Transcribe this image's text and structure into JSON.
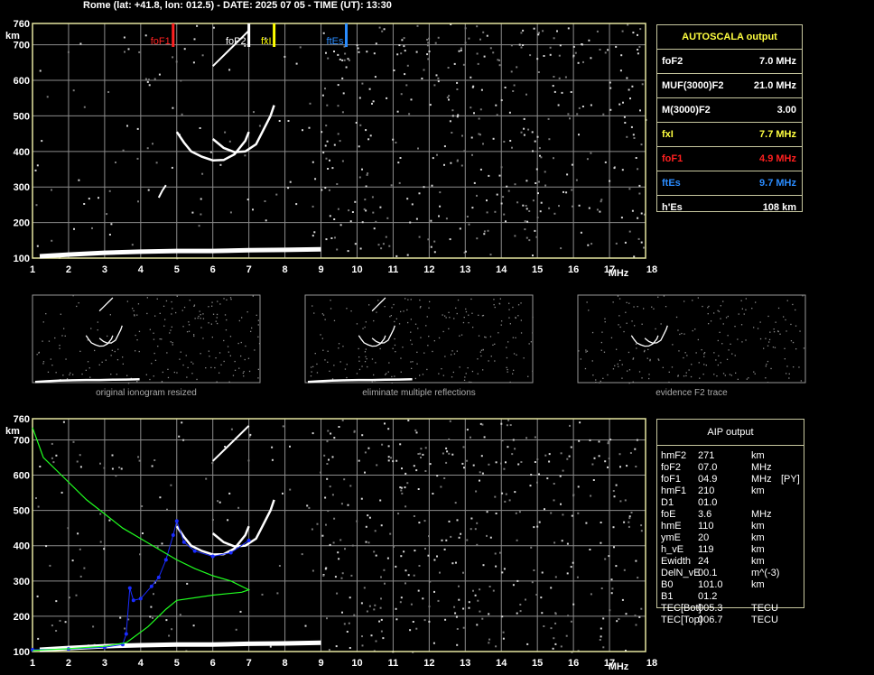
{
  "header": {
    "text": "Rome (lat: +41.8, lon: 012.5) - DATE: 2025 07 05 - TIME (UT): 13:30"
  },
  "colors": {
    "grid": "#8c8c8c",
    "frame": "#e6e6a0",
    "foF1": "#ff2020",
    "foF2": "#ffffff",
    "fxI": "#ffff00",
    "ftEs": "#2a8cff",
    "profile": "#20ff20",
    "aip_trace": "#1a2cff",
    "noise": "#d8d8d8"
  },
  "main_chart": {
    "x_ticks": [
      "1",
      "2",
      "3",
      "4",
      "5",
      "6",
      "7",
      "8",
      "9",
      "10",
      "11",
      "12",
      "13",
      "14",
      "15",
      "16",
      "17",
      "18"
    ],
    "x_unit": "MHz",
    "y_ticks": [
      "100",
      "200",
      "300",
      "400",
      "500",
      "600",
      "700",
      "760"
    ],
    "y_unit": "km",
    "markers": [
      {
        "label": "foF1",
        "freq": 4.9
      },
      {
        "label": "foP2",
        "freq": 7.0
      },
      {
        "label": "fxI",
        "freq": 7.7
      },
      {
        "label": "ftEs",
        "freq": 9.7
      }
    ]
  },
  "thumbnails": [
    {
      "caption": "original ionogram resized"
    },
    {
      "caption": "eliminate multiple reflections"
    },
    {
      "caption": "evidence F2 trace"
    }
  ],
  "autoscala": {
    "title": "AUTOSCALA output",
    "rows": [
      {
        "key": "foF2",
        "value": "7.0 MHz",
        "color": "#ffffff"
      },
      {
        "key": "MUF(3000)F2",
        "value": "21.0 MHz",
        "color": "#ffffff"
      },
      {
        "key": "M(3000)F2",
        "value": "3.00",
        "color": "#ffffff"
      },
      {
        "key": "fxI",
        "value": "7.7 MHz",
        "color": "#ffff40"
      },
      {
        "key": "foF1",
        "value": "4.9 MHz",
        "color": "#ff2020"
      },
      {
        "key": "ftEs",
        "value": "9.7 MHz",
        "color": "#2a8cff"
      },
      {
        "key": "h'Es",
        "value": "108    km",
        "color": "#ffffff"
      }
    ]
  },
  "aip": {
    "title": "AIP output",
    "rows": [
      {
        "key": "hmF2",
        "value": "271",
        "unit": "km",
        "extra": ""
      },
      {
        "key": "foF2",
        "value": "07.0",
        "unit": "MHz",
        "extra": ""
      },
      {
        "key": "foF1",
        "value": "04.9",
        "unit": "MHz",
        "extra": "[PY]"
      },
      {
        "key": "hmF1",
        "value": "210",
        "unit": "km",
        "extra": ""
      },
      {
        "key": "D1",
        "value": "01.0",
        "unit": "",
        "extra": ""
      },
      {
        "key": "foE",
        "value": "3.6",
        "unit": "MHz",
        "extra": ""
      },
      {
        "key": "hmE",
        "value": "110",
        "unit": "km",
        "extra": ""
      },
      {
        "key": "ymE",
        "value": "20",
        "unit": "km",
        "extra": ""
      },
      {
        "key": "h_vE",
        "value": "119",
        "unit": "km",
        "extra": ""
      },
      {
        "key": "Ewidth",
        "value": "24",
        "unit": "km",
        "extra": ""
      },
      {
        "key": "DelN_vE",
        "value": "00.1",
        "unit": "m^(-3)",
        "extra": ""
      },
      {
        "key": "B0",
        "value": "101.0",
        "unit": "km",
        "extra": ""
      },
      {
        "key": "B1",
        "value": "01.2",
        "unit": "",
        "extra": ""
      },
      {
        "key": "TEC[Bot]",
        "value": "005.3",
        "unit": "TECU",
        "extra": ""
      },
      {
        "key": "TEC[Top]",
        "value": "006.7",
        "unit": "TECU",
        "extra": ""
      }
    ]
  },
  "chart_data": [
    {
      "type": "scatter",
      "title": "",
      "xlabel": "MHz",
      "ylabel": "km",
      "xlim": [
        1,
        18
      ],
      "ylim": [
        100,
        760
      ],
      "grid": true,
      "series": [
        {
          "name": "foF1",
          "points": [
            [
              4.9,
              760
            ],
            [
              4.9,
              690
            ]
          ]
        },
        {
          "name": "foP2",
          "points": [
            [
              7.0,
              760
            ],
            [
              7.0,
              690
            ]
          ]
        },
        {
          "name": "fxI",
          "points": [
            [
              7.7,
              760
            ],
            [
              7.7,
              690
            ]
          ]
        },
        {
          "name": "ftEs",
          "points": [
            [
              9.7,
              760
            ],
            [
              9.7,
              690
            ]
          ]
        },
        {
          "points": [
            [
              1.2,
              105
            ],
            [
              2,
              110
            ],
            [
              3,
              115
            ],
            [
              4,
              118
            ],
            [
              5,
              120
            ],
            [
              6,
              120
            ],
            [
              7,
              122
            ],
            [
              8,
              123
            ],
            [
              9,
              125
            ]
          ]
        },
        {
          "points": [
            [
              5.0,
              455
            ],
            [
              5.2,
              425
            ],
            [
              5.4,
              400
            ],
            [
              5.7,
              385
            ],
            [
              6.0,
              375
            ],
            [
              6.3,
              376
            ],
            [
              6.6,
              392
            ],
            [
              6.9,
              430
            ],
            [
              7.0,
              455
            ]
          ]
        },
        {
          "points": [
            [
              6.0,
              435
            ],
            [
              6.3,
              410
            ],
            [
              6.6,
              398
            ],
            [
              6.9,
              400
            ],
            [
              7.2,
              420
            ],
            [
              7.4,
              460
            ],
            [
              7.6,
              500
            ],
            [
              7.7,
              530
            ]
          ]
        },
        {
          "points": [
            [
              6.0,
              640
            ],
            [
              6.2,
              660
            ],
            [
              6.5,
              690
            ],
            [
              6.8,
              720
            ],
            [
              7.0,
              740
            ]
          ]
        },
        {
          "points": [
            [
              4.5,
              270
            ],
            [
              4.6,
              290
            ],
            [
              4.7,
              305
            ]
          ]
        }
      ]
    },
    {
      "type": "scatter",
      "title": "",
      "xlabel": "MHz",
      "ylabel": "km",
      "xlim": [
        1,
        18
      ],
      "ylim": [
        100,
        760
      ],
      "grid": true,
      "series": [
        {
          "points": [
            [
              1.2,
              105
            ],
            [
              2,
              110
            ],
            [
              3,
              115
            ],
            [
              4,
              118
            ],
            [
              5,
              120
            ],
            [
              6,
              120
            ],
            [
              7,
              122
            ],
            [
              8,
              123
            ],
            [
              9,
              125
            ]
          ]
        },
        {
          "points": [
            [
              5.0,
              455
            ],
            [
              5.2,
              425
            ],
            [
              5.4,
              400
            ],
            [
              5.7,
              385
            ],
            [
              6.0,
              375
            ],
            [
              6.3,
              376
            ],
            [
              6.6,
              392
            ],
            [
              6.9,
              430
            ],
            [
              7.0,
              455
            ]
          ]
        },
        {
          "points": [
            [
              6.0,
              435
            ],
            [
              6.3,
              410
            ],
            [
              6.6,
              398
            ],
            [
              6.9,
              400
            ],
            [
              7.2,
              420
            ],
            [
              7.4,
              460
            ],
            [
              7.6,
              500
            ],
            [
              7.7,
              530
            ]
          ]
        },
        {
          "points": [
            [
              6.0,
              640
            ],
            [
              6.2,
              660
            ],
            [
              6.5,
              690
            ],
            [
              6.8,
              720
            ],
            [
              7.0,
              740
            ]
          ]
        },
        {
          "points": [
            [
              1.0,
              105
            ],
            [
              2.0,
              107
            ],
            [
              3.0,
              112
            ],
            [
              3.5,
              120
            ],
            [
              3.6,
              150
            ],
            [
              3.7,
              280
            ],
            [
              3.8,
              245
            ],
            [
              4.0,
              250
            ],
            [
              4.3,
              285
            ],
            [
              4.5,
              310
            ],
            [
              4.7,
              360
            ],
            [
              4.9,
              430
            ],
            [
              5.0,
              470
            ],
            [
              5.2,
              410
            ],
            [
              5.5,
              385
            ],
            [
              6.0,
              370
            ],
            [
              6.5,
              380
            ],
            [
              7.0,
              415
            ]
          ]
        },
        {
          "points": [
            [
              1.0,
              735
            ],
            [
              1.3,
              650
            ],
            [
              1.8,
              600
            ],
            [
              2.5,
              530
            ],
            [
              3.0,
              490
            ],
            [
              3.5,
              450
            ],
            [
              4.0,
              420
            ],
            [
              4.5,
              390
            ],
            [
              5.0,
              360
            ],
            [
              5.5,
              335
            ],
            [
              6.0,
              315
            ],
            [
              6.5,
              300
            ],
            [
              7.0,
              275
            ],
            [
              6.8,
              268
            ],
            [
              6.0,
              260
            ],
            [
              5.0,
              245
            ],
            [
              4.7,
              220
            ],
            [
              4.5,
              200
            ],
            [
              4.2,
              170
            ],
            [
              3.8,
              140
            ],
            [
              3.6,
              125
            ],
            [
              3.0,
              115
            ],
            [
              2.0,
              108
            ],
            [
              1.0,
              103
            ]
          ]
        }
      ]
    }
  ]
}
